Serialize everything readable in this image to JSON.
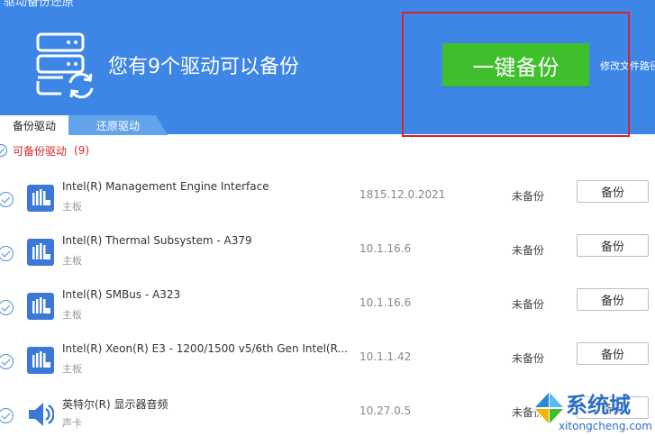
{
  "window": {
    "title": "驱动备份还原"
  },
  "header": {
    "message": "您有9个驱动可以备份",
    "primary_button": "一键备份",
    "path_link": "修改文件路径"
  },
  "tabs": [
    {
      "label": "备份驱动",
      "active": true
    },
    {
      "label": "还原驱动",
      "active": false
    }
  ],
  "group": {
    "label": "可备份驱动",
    "count": "(9)"
  },
  "drivers": [
    {
      "name": "Intel(R) Management Engine Interface",
      "category": "主板",
      "version": "1815.12.0.2021",
      "status": "未备份",
      "action": "备份",
      "icon": "chip-icon"
    },
    {
      "name": "Intel(R) Thermal Subsystem - A379",
      "category": "主板",
      "version": "10.1.16.6",
      "status": "未备份",
      "action": "备份",
      "icon": "chip-icon"
    },
    {
      "name": "Intel(R) SMBus - A323",
      "category": "主板",
      "version": "10.1.16.6",
      "status": "未备份",
      "action": "备份",
      "icon": "chip-icon"
    },
    {
      "name": "Intel(R) Xeon(R) E3 - 1200/1500 v5/6th Gen Intel(R...",
      "category": "主板",
      "version": "10.1.1.42",
      "status": "未备份",
      "action": "备份",
      "icon": "chip-icon"
    },
    {
      "name": "英特尔(R) 显示器音频",
      "category": "声卡",
      "version": "10.27.0.5",
      "status": "未备份",
      "action": "备份",
      "icon": "speaker-icon"
    }
  ],
  "watermark": {
    "brand": "系统城",
    "url": "xitongcheng.com"
  },
  "colors": {
    "header_bg": "#3d86e6",
    "primary_button": "#3fbf2c",
    "highlight": "#d9222a",
    "group_label": "#d9262a"
  }
}
